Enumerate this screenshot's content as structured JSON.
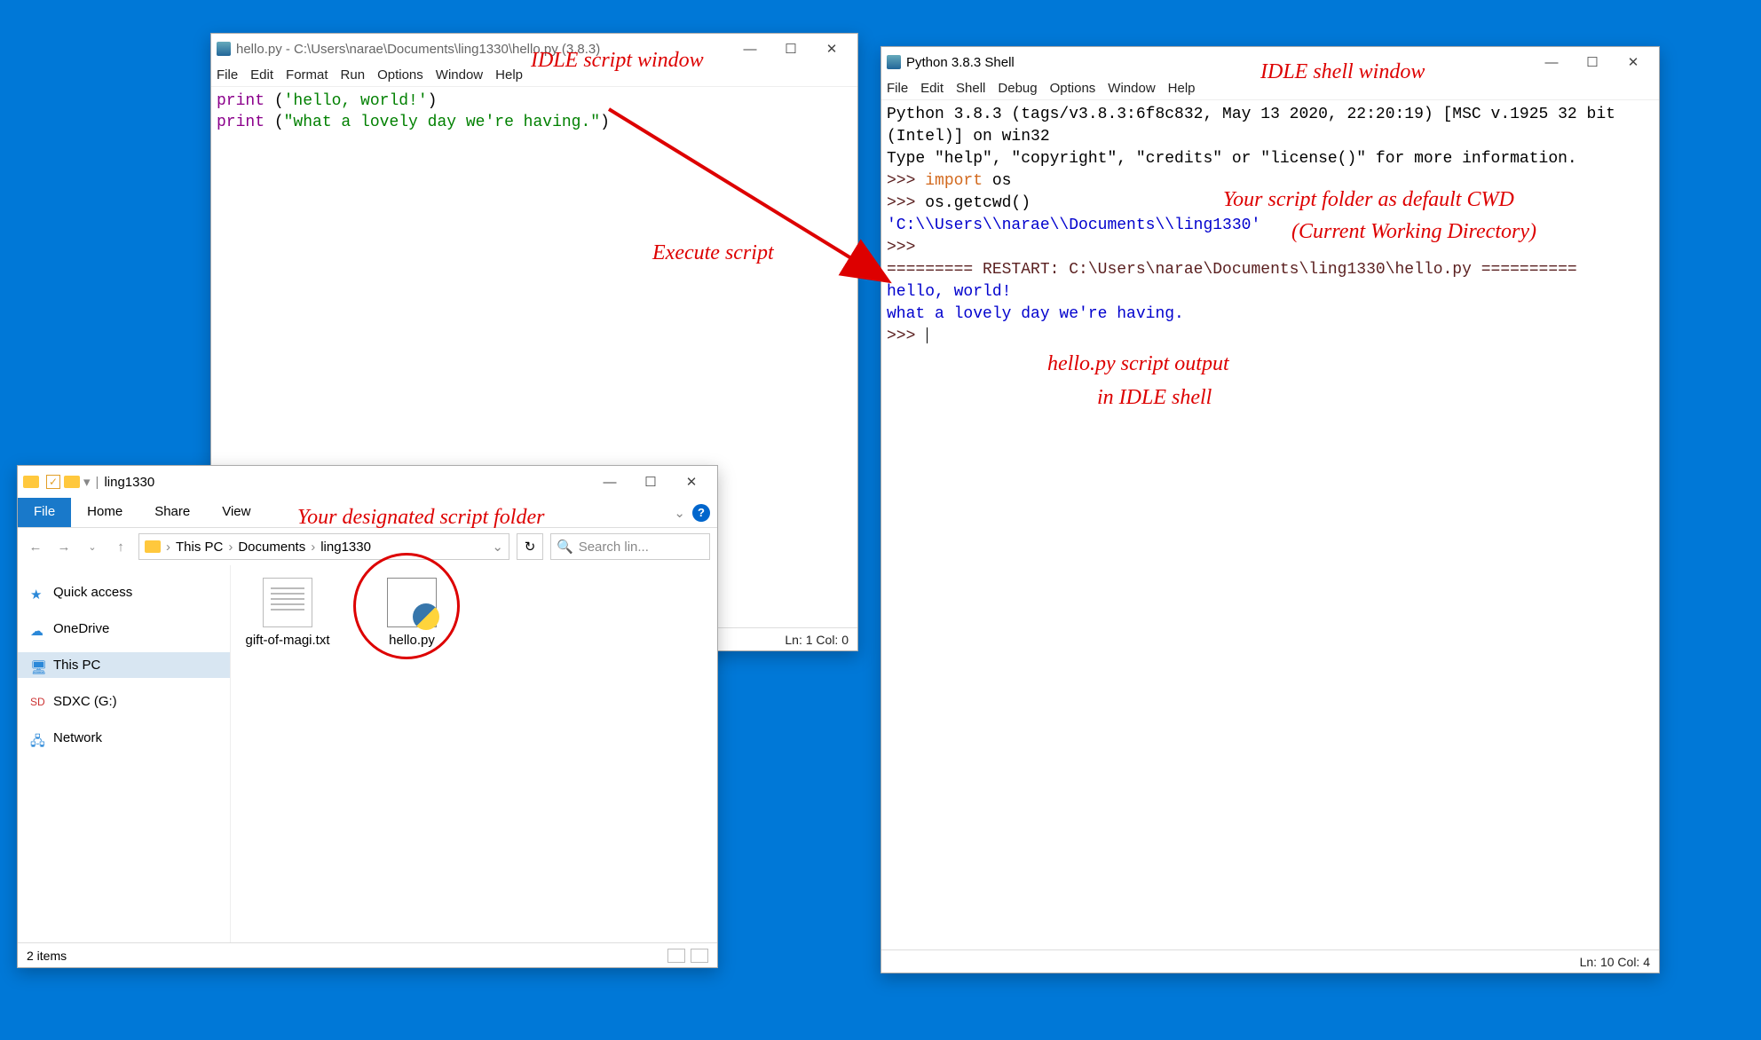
{
  "annotations": {
    "script_window": "IDLE script window",
    "shell_window": "IDLE shell window",
    "execute": "Execute script",
    "folder": "Your designated script folder",
    "cwd1": "Your script folder as default CWD",
    "cwd2": "(Current Working Directory)",
    "output1": "hello.py script output",
    "output2": "in IDLE shell"
  },
  "script_window": {
    "title": "hello.py - C:\\Users\\narae\\Documents\\ling1330\\hello.py (3.8.3)",
    "menu": [
      "File",
      "Edit",
      "Format",
      "Run",
      "Options",
      "Window",
      "Help"
    ],
    "code": {
      "line1_kw": "print",
      "line1_rest": " (",
      "line1_str": "'hello, world!'",
      "line1_end": ")",
      "line2_kw": "print",
      "line2_rest": " (",
      "line2_str": "\"what a lovely day we're having.\"",
      "line2_end": ")"
    },
    "status": "Ln: 1  Col: 0"
  },
  "shell_window": {
    "title": "Python 3.8.3 Shell",
    "menu": [
      "File",
      "Edit",
      "Shell",
      "Debug",
      "Options",
      "Window",
      "Help"
    ],
    "banner1": "Python 3.8.3 (tags/v3.8.3:6f8c832, May 13 2020, 22:20:19) [MSC v.1925 32 bit (Intel)] on win32",
    "banner2": "Type \"help\", \"copyright\", \"credits\" or \"license()\" for more information.",
    "prompt": ">>> ",
    "import_kw": "import",
    "import_rest": " os",
    "getcwd": "os.getcwd()",
    "cwd_out": "'C:\\\\Users\\\\narae\\\\Documents\\\\ling1330'",
    "restart": "========= RESTART: C:\\Users\\narae\\Documents\\ling1330\\hello.py ==========",
    "out1": "hello, world!",
    "out2": "what a lovely day we're having.",
    "status": "Ln: 10  Col: 4"
  },
  "explorer": {
    "title_app": "ling1330",
    "ribbon_tabs": [
      "File",
      "Home",
      "Share",
      "View"
    ],
    "breadcrumb": [
      "This PC",
      "Documents",
      "ling1330"
    ],
    "search_placeholder": "Search lin...",
    "nav": [
      {
        "label": "Quick access",
        "icon": "star"
      },
      {
        "label": "OneDrive",
        "icon": "cloud"
      },
      {
        "label": "This PC",
        "icon": "pc",
        "selected": true
      },
      {
        "label": "SDXC (G:)",
        "icon": "sd"
      },
      {
        "label": "Network",
        "icon": "net"
      }
    ],
    "files": [
      {
        "name": "gift-of-magi.txt",
        "type": "txt"
      },
      {
        "name": "hello.py",
        "type": "py",
        "circled": true
      }
    ],
    "status": "2 items"
  }
}
